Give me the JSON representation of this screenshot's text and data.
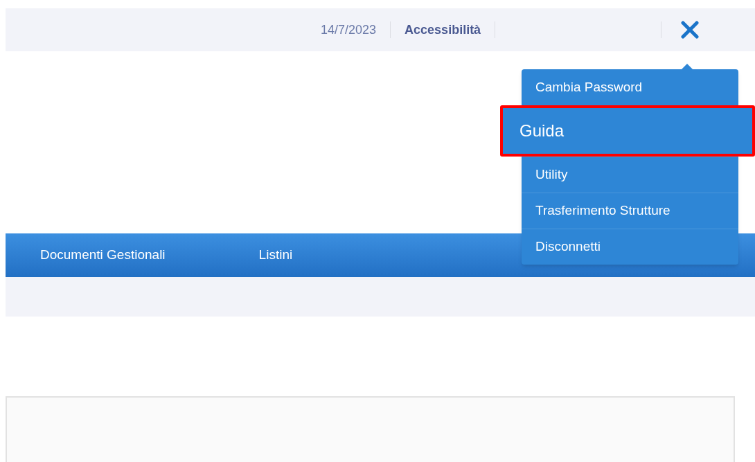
{
  "top_bar": {
    "date": "14/7/2023",
    "accessibility_link": "Accessibilità"
  },
  "nav": {
    "items": [
      {
        "label": "Documenti Gestionali"
      },
      {
        "label": "Listini"
      }
    ]
  },
  "user_menu": {
    "items": [
      {
        "label": "Cambia Password",
        "selected": false
      },
      {
        "label": "Guida",
        "selected": true
      },
      {
        "label": "Utility",
        "selected": false
      },
      {
        "label": "Trasferimento Strutture",
        "selected": false
      },
      {
        "label": "Disconnetti",
        "selected": false
      }
    ]
  }
}
